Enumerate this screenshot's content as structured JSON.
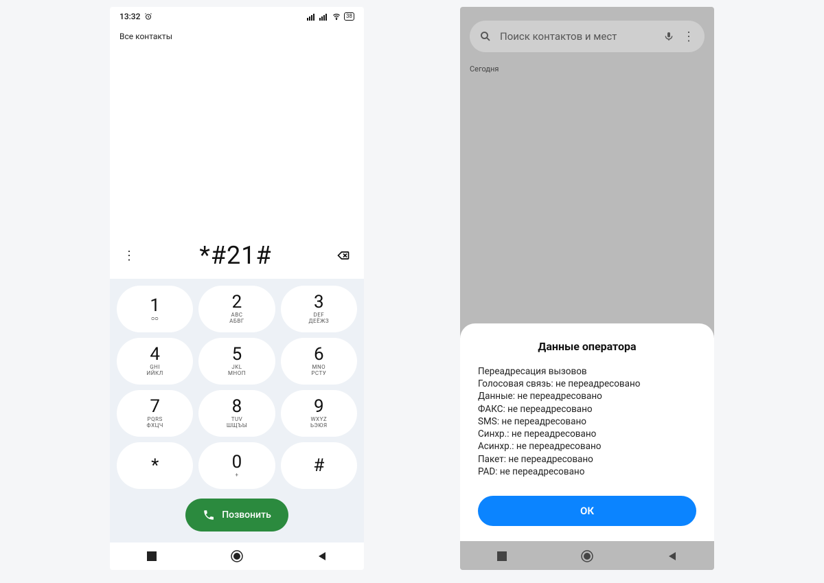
{
  "left": {
    "status": {
      "time": "13:32",
      "battery": "38"
    },
    "all_contacts": "Все контакты",
    "dialed": "*#21#",
    "keys": [
      {
        "d": "1",
        "s": "ᴑᴑ"
      },
      {
        "d": "2",
        "s": "ABC\nАБВГ"
      },
      {
        "d": "3",
        "s": "DEF\nДЕЁЖЗ"
      },
      {
        "d": "4",
        "s": "GHI\nИЙКЛ"
      },
      {
        "d": "5",
        "s": "JKL\nМНОП"
      },
      {
        "d": "6",
        "s": "MNO\nРСТУ"
      },
      {
        "d": "7",
        "s": "PQRS\nФХЦЧ"
      },
      {
        "d": "8",
        "s": "TUV\nШЩЪЫ"
      },
      {
        "d": "9",
        "s": "WXYZ\nЬЭЮЯ"
      },
      {
        "d": "*",
        "s": ""
      },
      {
        "d": "0",
        "s": "+"
      },
      {
        "d": "#",
        "s": ""
      }
    ],
    "call_label": "Позвонить"
  },
  "right": {
    "search_placeholder": "Поиск контактов и мест",
    "section": "Сегодня",
    "sheet_title": "Данные оператора",
    "sheet_lines": [
      "Переадресация вызовов",
      "Голосовая связь: не переадресовано",
      "Данные: не переадресовано",
      "ФАКС: не переадресовано",
      "SMS: не переадресовано",
      "Синхр.: не переадресовано",
      "Асинхр.: не переадресовано",
      "Пакет: не переадресовано",
      "PAD: не переадресовано"
    ],
    "ok": "ОК"
  }
}
